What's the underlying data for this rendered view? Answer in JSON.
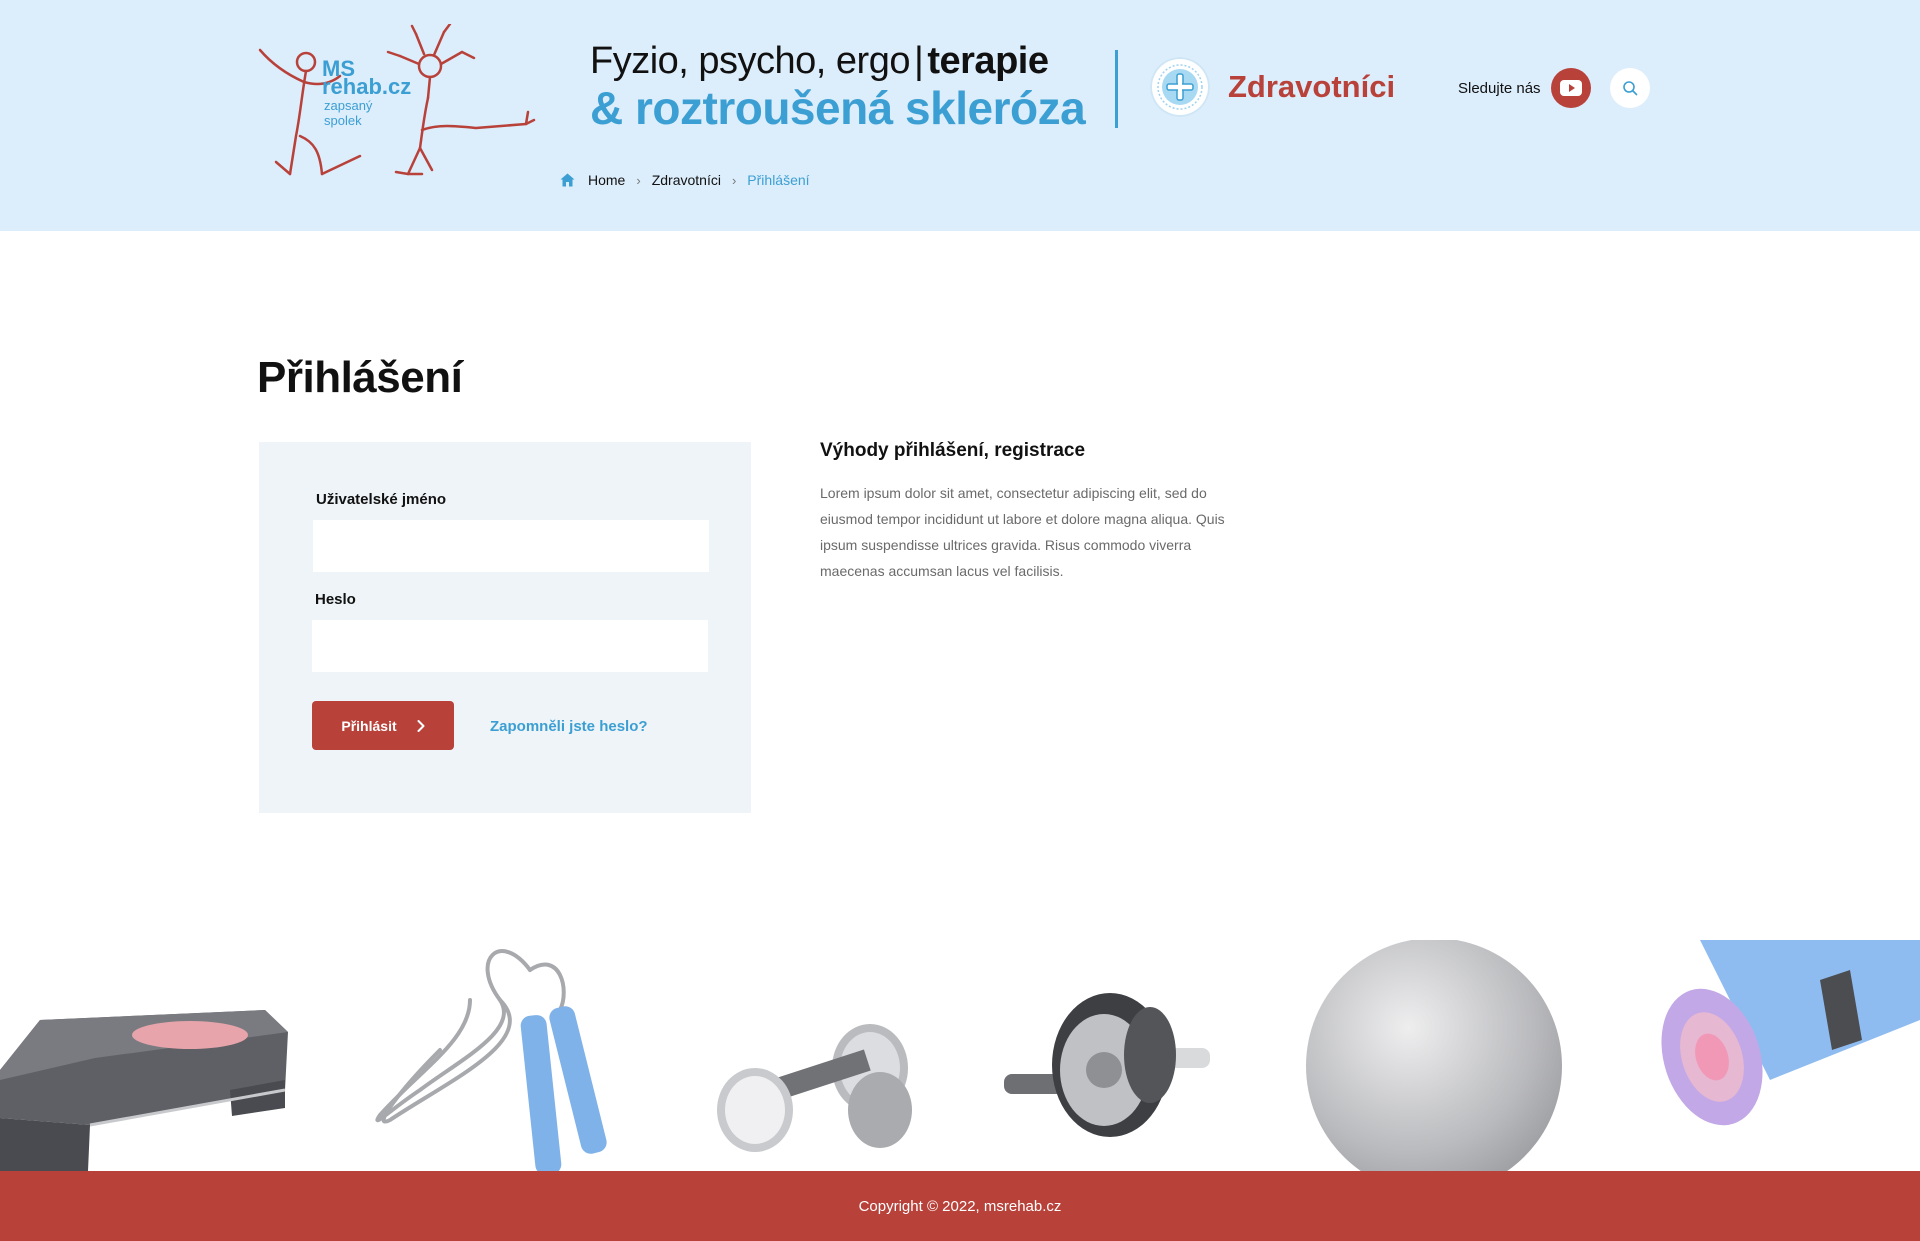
{
  "header": {
    "logo": {
      "line1": "MS",
      "line2": "rehab.cz",
      "line3": "zapsaný",
      "line4": "spolek"
    },
    "tagline": {
      "part1": "Fyzio, psycho, ergo",
      "separator": "|",
      "part2": "terapie",
      "line2": "& roztroušená skleróza"
    },
    "section": {
      "label": "Zdravotníci",
      "icon": "plus-icon"
    },
    "follow_label": "Sledujte nás",
    "breadcrumb": [
      {
        "label": "Home"
      },
      {
        "label": "Zdravotníci"
      },
      {
        "label": "Přihlášení"
      }
    ]
  },
  "main": {
    "title": "Přihlášení",
    "form": {
      "username_label": "Uživatelské jméno",
      "username_value": "",
      "password_label": "Heslo",
      "password_value": "",
      "submit_label": "Přihlásit",
      "forgot_label": "Zapomněli jste heslo?"
    },
    "benefits": {
      "title": "Výhody přihlášení, registrace",
      "text": "Lorem ipsum dolor sit amet, consectetur adipiscing elit, sed do eiusmod tempor incididunt ut labore et dolore magna aliqua. Quis ipsum suspendisse ultrices gravida. Risus commodo viverra maecenas accumsan lacus vel facilisis."
    }
  },
  "equipment": [
    "aerobic-step",
    "jump-rope",
    "dumbbells",
    "ab-wheel",
    "fitness-ball",
    "yoga-mat"
  ],
  "footer": {
    "copyright": "Copyright © 2022, msrehab.cz"
  },
  "colors": {
    "header_bg": "#dcedfb",
    "accent_blue": "#3c9fd3",
    "accent_red": "#b8413a",
    "form_bg": "#eef4f8"
  }
}
